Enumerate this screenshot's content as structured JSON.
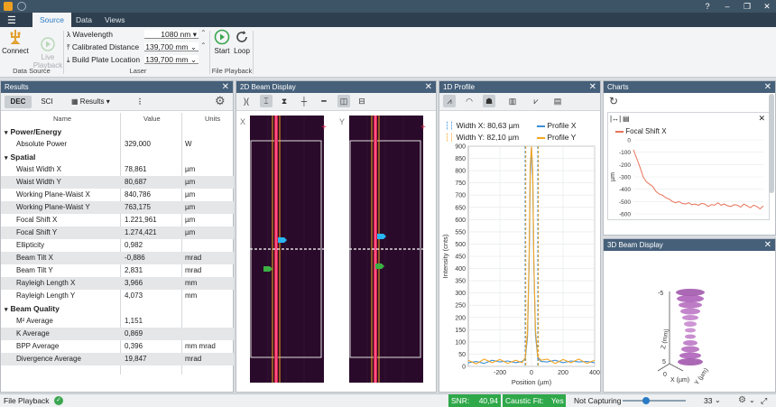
{
  "menu": {
    "tabs": [
      "Source",
      "Data",
      "Views"
    ]
  },
  "ribbon": {
    "connect_label": "Connect",
    "live_label": "Live\nPlayback",
    "data_source_label": "Data Source",
    "wavelength_label": "Wavelength",
    "wavelength_value": "1080 nm",
    "calib_label": "Calibrated Distance",
    "calib_value": "139,700 mm",
    "build_label": "Build Plate Location",
    "build_value": "139,700 mm",
    "laser_label": "Laser",
    "start_label": "Start",
    "loop_label": "Loop",
    "file_playback_label": "File Playback"
  },
  "results": {
    "title": "Results",
    "tab_dec": "DEC",
    "tab_sci": "SCI",
    "dropdown": "Results",
    "col_name": "Name",
    "col_value": "Value",
    "col_units": "Units",
    "rows": [
      {
        "type": "section",
        "name": "Power/Energy"
      },
      {
        "name": "Absolute Power",
        "value": "329,000",
        "units": "W"
      },
      {
        "type": "section",
        "name": "Spatial"
      },
      {
        "name": "Waist Width X",
        "value": "78,861",
        "units": "µm"
      },
      {
        "name": "Waist Width Y",
        "value": "80,687",
        "units": "µm"
      },
      {
        "name": "Working Plane-Waist X",
        "value": "840,786",
        "units": "µm"
      },
      {
        "name": "Working Plane-Waist Y",
        "value": "763,175",
        "units": "µm"
      },
      {
        "name": "Focal Shift X",
        "value": "1.221,961",
        "units": "µm"
      },
      {
        "name": "Focal Shift Y",
        "value": "1.274,421",
        "units": "µm"
      },
      {
        "name": "Ellipticity",
        "value": "0,982",
        "units": ""
      },
      {
        "name": "Beam Tilt X",
        "value": "-0,886",
        "units": "mrad"
      },
      {
        "name": "Beam Tilt Y",
        "value": "2,831",
        "units": "mrad"
      },
      {
        "name": "Rayleigh Length X",
        "value": "3,966",
        "units": "mm"
      },
      {
        "name": "Rayleigh Length Y",
        "value": "4,073",
        "units": "mm"
      },
      {
        "type": "section",
        "name": "Beam Quality"
      },
      {
        "name": "M² Average",
        "value": "1,151",
        "units": ""
      },
      {
        "name": "K Average",
        "value": "0,869",
        "units": ""
      },
      {
        "name": "BPP Average",
        "value": "0,396",
        "units": "mm mrad"
      },
      {
        "name": "Divergence Average",
        "value": "19,847",
        "units": "mrad"
      }
    ]
  },
  "beam2d": {
    "title": "2D Beam Display",
    "x_label": "X",
    "y_label": "Y"
  },
  "profile1d": {
    "title": "1D Profile",
    "width_x": "Width X: 80,63 µm",
    "width_y": "Width Y: 82,10 µm",
    "legend_x": "Profile X",
    "legend_y": "Profile Y",
    "color_x": "#3a8fd8",
    "color_y": "#f5a623"
  },
  "charts": {
    "title": "Charts",
    "legend": "Focal Shift X",
    "color": "#e8735a"
  },
  "beam3d": {
    "title": "3D Beam Display",
    "axis_z": "Z (mm)",
    "axis_x": "X (µm)",
    "axis_y": "Y (µm)",
    "tick_top": "-5",
    "tick_bottom": "5",
    "tick_zero": "0"
  },
  "chart_data": [
    {
      "type": "line",
      "title": "",
      "xlabel": "Position (µm)",
      "ylabel": "Intensity (cnts)",
      "xlim": [
        -400,
        400
      ],
      "ylim": [
        0,
        900
      ],
      "xticks": [
        "-200",
        "0",
        "200",
        "400"
      ],
      "yticks": [
        "0",
        "50",
        "100",
        "150",
        "200",
        "250",
        "300",
        "350",
        "400",
        "450",
        "500",
        "550",
        "600",
        "650",
        "700",
        "750",
        "800",
        "850",
        "900"
      ],
      "series": [
        {
          "name": "Profile X",
          "x": [
            -400,
            -350,
            -300,
            -250,
            -200,
            -150,
            -100,
            -60,
            -40,
            -25,
            -15,
            -8,
            0,
            8,
            15,
            25,
            40,
            60,
            100,
            150,
            200,
            250,
            300,
            350,
            400
          ],
          "y": [
            15,
            20,
            12,
            25,
            18,
            22,
            15,
            20,
            30,
            120,
            420,
            780,
            895,
            780,
            420,
            130,
            35,
            20,
            18,
            25,
            15,
            22,
            18,
            20,
            15
          ]
        },
        {
          "name": "Profile Y",
          "x": [
            -400,
            -350,
            -300,
            -250,
            -200,
            -150,
            -100,
            -60,
            -40,
            -25,
            -15,
            -8,
            0,
            8,
            15,
            25,
            40,
            60,
            100,
            150,
            200,
            250,
            300,
            350,
            400
          ],
          "y": [
            25,
            10,
            30,
            15,
            28,
            12,
            25,
            15,
            35,
            140,
            450,
            820,
            900,
            800,
            440,
            150,
            40,
            25,
            30,
            12,
            28,
            15,
            30,
            12,
            25
          ]
        }
      ]
    },
    {
      "type": "line",
      "title": "",
      "xlabel": "",
      "ylabel": "µm",
      "ylim": [
        -600,
        0
      ],
      "yticks": [
        "0",
        "-100",
        "-200",
        "-300",
        "-400",
        "-500",
        "-600"
      ],
      "series": [
        {
          "name": "Focal Shift X",
          "values": [
            -80,
            -150,
            -220,
            -300,
            -340,
            -360,
            -380,
            -420,
            -440,
            -450,
            -470,
            -480,
            -500,
            -510,
            -500,
            -515,
            -520,
            -510,
            -525,
            -520,
            -530,
            -515,
            -520,
            -540,
            -525,
            -530,
            -510,
            -530,
            -520,
            -535,
            -540,
            -525,
            -530,
            -545,
            -520,
            -535,
            -550,
            -530,
            -540,
            -560,
            -535
          ]
        }
      ]
    }
  ],
  "status": {
    "left": "File Playback",
    "snr_label": "SNR:",
    "snr_value": "40,94",
    "fit_label": "Caustic Fit:",
    "fit_value": "Yes",
    "capture": "Not Capturing",
    "zoom_value": "33"
  }
}
